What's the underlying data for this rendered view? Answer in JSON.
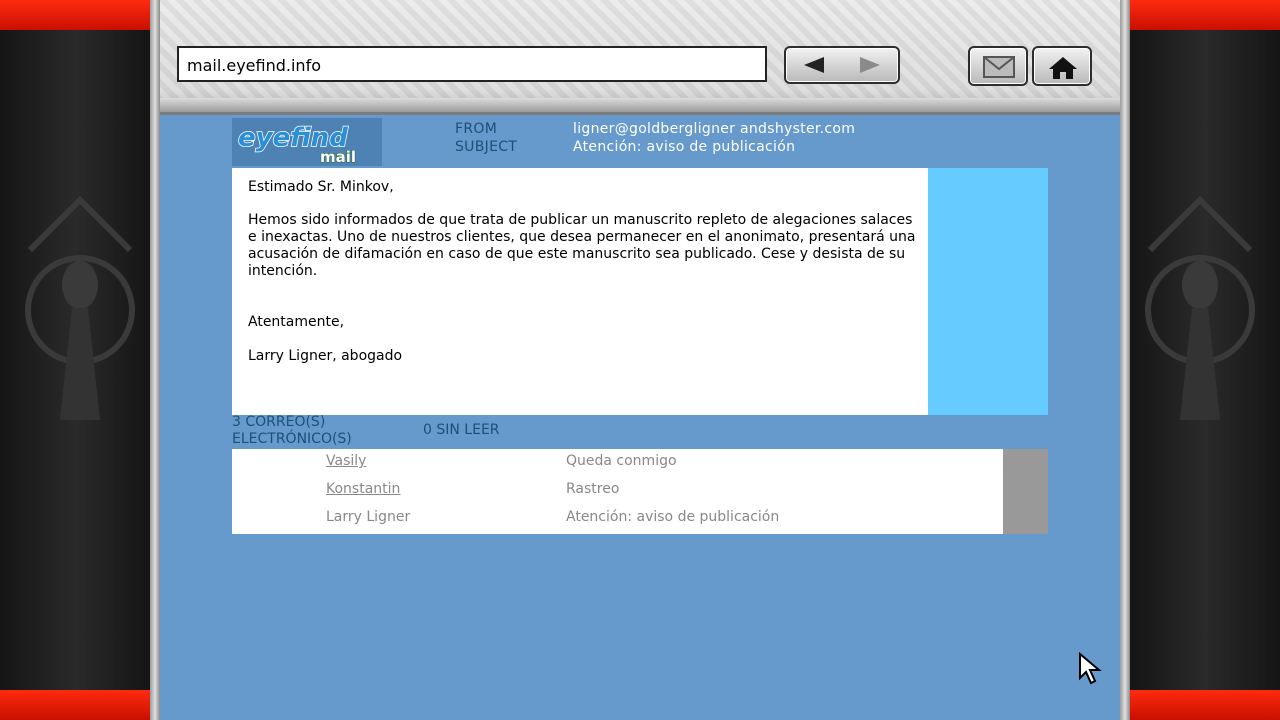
{
  "browser": {
    "address": "mail.eyefind.info"
  },
  "logo": {
    "text_top": "eyefind",
    "text_bottom": "mail"
  },
  "email": {
    "from_label": "FROM",
    "subject_label": "SUBJECT",
    "from": "ligner@goldbergligner andshyster.com",
    "subject": "Atención: aviso de publicación",
    "greeting": "Estimado Sr. Minkov,",
    "body": "Hemos sido informados de que trata de publicar un manuscrito repleto de alegaciones salaces e inexactas. Uno de nuestros clientes, que desea permanecer en el anonimato, presentará una acusación de difamación en caso de que este manuscrito sea publicado. Cese y desista de su intención.",
    "closing": "Atentamente,",
    "signature": "Larry Ligner, abogado"
  },
  "inbox": {
    "count_line1": "3 CORREO(S)",
    "count_line2": "ELECTRÓNICO(S)",
    "unread": "0 SIN LEER",
    "messages": [
      {
        "sender": "Vasily",
        "subject": "Queda conmigo"
      },
      {
        "sender": "Konstantin",
        "subject": "Rastreo"
      },
      {
        "sender": "Larry Ligner",
        "subject": "Atención: aviso de publicación"
      }
    ]
  },
  "colors": {
    "page_bg": "#6699cc",
    "label": "#1f4e79",
    "side_panel": "#66ccff",
    "scrollbar": "#999999",
    "accent_red": "#ff2a10"
  }
}
